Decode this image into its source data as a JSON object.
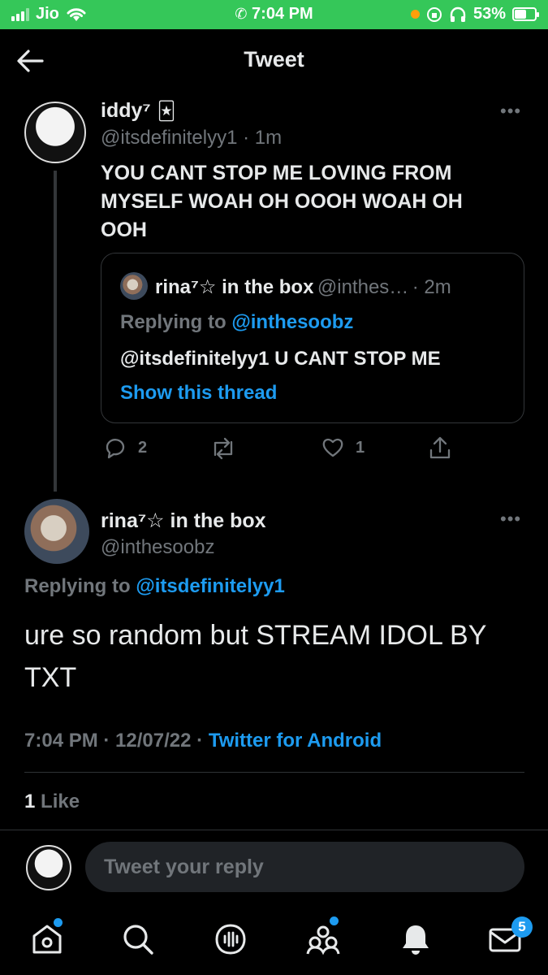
{
  "status_bar": {
    "carrier": "Jio",
    "time": "7:04 PM",
    "battery": "53%",
    "battery_level": 0.53
  },
  "header": {
    "title": "Tweet"
  },
  "thread_tweet": {
    "name": "iddy⁷",
    "name_emoji": "🃏",
    "handle": "@itsdefinitelyy1",
    "time": "1m",
    "text_line1": "YOU CANT STOP ME LOVING FROM",
    "text_line2": "MYSELF WOAH OH OOOH WOAH OH",
    "text_line3": "OOH",
    "quote": {
      "name": "rina⁷☆ in the box",
      "handle": "@inthes…",
      "time": "2m",
      "replying_prefix": "Replying to",
      "replying_to": "@inthesoobz",
      "text": "@itsdefinitelyy1 U CANT STOP ME",
      "show_thread": "Show this thread"
    },
    "reply_count": "2",
    "like_count": "1"
  },
  "main_tweet": {
    "name": "rina⁷☆ in the box",
    "handle": "@inthesoobz",
    "replying_prefix": "Replying to",
    "replying_to": "@itsdefinitelyy1",
    "text_line1": "ure so random but STREAM IDOL BY",
    "text_line2": "TXT",
    "time": "7:04 PM",
    "date": "12/07/22",
    "source": "Twitter for Android",
    "likes_count": "1",
    "likes_label": "Like"
  },
  "reply": {
    "placeholder": "Tweet your reply"
  },
  "bottom_nav": {
    "messages_badge": "5"
  },
  "colors": {
    "status_green": "#35c759",
    "accent_blue": "#1d9bf0",
    "muted": "#71767b"
  }
}
